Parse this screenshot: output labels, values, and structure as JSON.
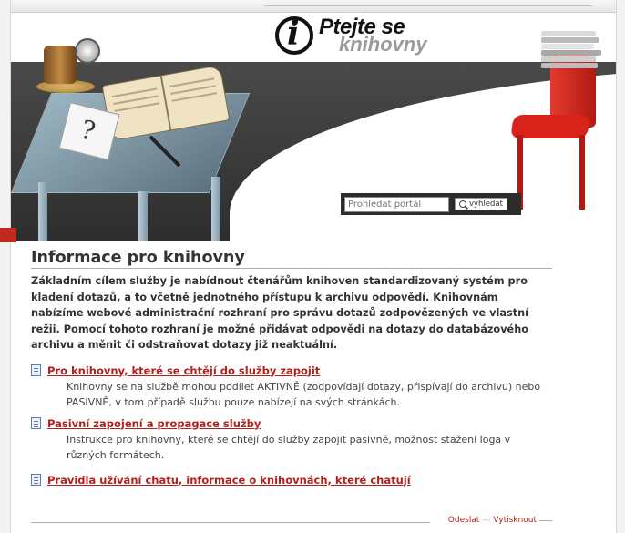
{
  "header": {
    "logo_line1": "Ptejte se",
    "logo_line2": "knihovny",
    "logo_letter": "i"
  },
  "search": {
    "placeholder": "Prohledat portál",
    "button_label": "vyhledat"
  },
  "main": {
    "title": "Informace pro knihovny",
    "intro": "Základním cílem služby je nabídnout čtenářům knihoven standardizovaný systém pro kladení dotazů, a to včetně jednotného přístupu k archivu odpovědí. Knihovnám nabízíme webové administrační rozhraní pro správu dotazů zodpovězených ve vlastní režii. Pomocí tohoto rozhraní je možné přidávat odpovědi na dotazy do databázového archivu a měnit či odstraňovat dotazy již neaktuální.",
    "items": [
      {
        "link": "Pro knihovny, které se chtějí do služby zapojit",
        "description": "Knihovny se na službě mohou podílet AKTIVNĚ (zodpovídají dotazy, přispívají do archivu) nebo PASIVNĚ, v tom případě službu pouze nabízejí na svých stránkách."
      },
      {
        "link": "Pasivní zapojení a propagace služby",
        "description": "Instrukce pro knihovny, které se chtějí do služby zapojit pasivně, možnost stažení loga v různých formátech."
      },
      {
        "link": "Pravidla užívání chatu, informace o knihovnách, které chatují",
        "description": ""
      }
    ]
  },
  "footer": {
    "send_label": "Odeslat",
    "print_label": "Vytisknout"
  },
  "colors": {
    "link": "#b4201a",
    "accent_red": "#c2281c",
    "rule": "#9db4c4",
    "dark_band": "#2d2d2d"
  },
  "icons": [
    "document-icon",
    "magnifier-icon"
  ]
}
